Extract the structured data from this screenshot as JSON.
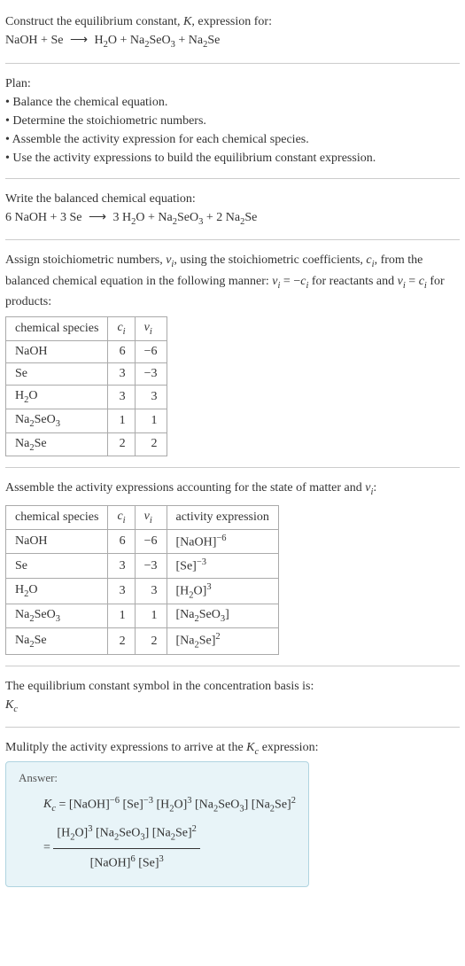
{
  "intro": {
    "line1": "Construct the equilibrium constant, K, expression for:",
    "equation": "NaOH + Se ⟶ H₂O + Na₂SeO₃ + Na₂Se"
  },
  "plan": {
    "header": "Plan:",
    "items": [
      "• Balance the chemical equation.",
      "• Determine the stoichiometric numbers.",
      "• Assemble the activity expression for each chemical species.",
      "• Use the activity expressions to build the equilibrium constant expression."
    ]
  },
  "balanced": {
    "header": "Write the balanced chemical equation:",
    "equation": "6 NaOH + 3 Se ⟶ 3 H₂O + Na₂SeO₃ + 2 Na₂Se"
  },
  "assign": {
    "text": "Assign stoichiometric numbers, νᵢ, using the stoichiometric coefficients, cᵢ, from the balanced chemical equation in the following manner: νᵢ = −cᵢ for reactants and νᵢ = cᵢ for products:"
  },
  "table1": {
    "headers": [
      "chemical species",
      "cᵢ",
      "νᵢ"
    ],
    "rows": [
      {
        "species": "NaOH",
        "c": "6",
        "v": "−6"
      },
      {
        "species": "Se",
        "c": "3",
        "v": "−3"
      },
      {
        "species": "H₂O",
        "c": "3",
        "v": "3"
      },
      {
        "species": "Na₂SeO₃",
        "c": "1",
        "v": "1"
      },
      {
        "species": "Na₂Se",
        "c": "2",
        "v": "2"
      }
    ]
  },
  "assemble": {
    "text": "Assemble the activity expressions accounting for the state of matter and νᵢ:"
  },
  "table2": {
    "headers": [
      "chemical species",
      "cᵢ",
      "νᵢ",
      "activity expression"
    ],
    "rows": [
      {
        "species": "NaOH",
        "c": "6",
        "v": "−6",
        "expr": "[NaOH]⁻⁶"
      },
      {
        "species": "Se",
        "c": "3",
        "v": "−3",
        "expr": "[Se]⁻³"
      },
      {
        "species": "H₂O",
        "c": "3",
        "v": "3",
        "expr": "[H₂O]³"
      },
      {
        "species": "Na₂SeO₃",
        "c": "1",
        "v": "1",
        "expr": "[Na₂SeO₃]"
      },
      {
        "species": "Na₂Se",
        "c": "2",
        "v": "2",
        "expr": "[Na₂Se]²"
      }
    ]
  },
  "symbol": {
    "line1": "The equilibrium constant symbol in the concentration basis is:",
    "sym": "K_c"
  },
  "multiply": {
    "text": "Mulitply the activity expressions to arrive at the K_c expression:"
  },
  "answer": {
    "label": "Answer:",
    "line1_lhs": "K_c = ",
    "line1_rhs": "[NaOH]⁻⁶ [Se]⁻³ [H₂O]³ [Na₂SeO₃] [Na₂Se]²",
    "line2_eq": "= ",
    "line2_num": "[H₂O]³ [Na₂SeO₃] [Na₂Se]²",
    "line2_den": "[NaOH]⁶ [Se]³"
  }
}
